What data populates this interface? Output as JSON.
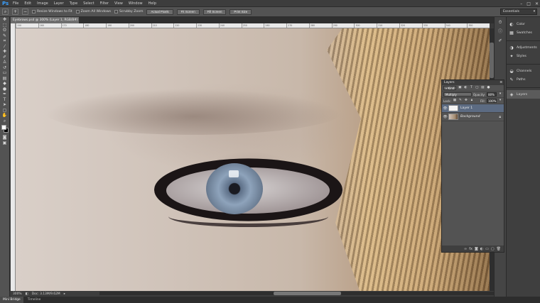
{
  "app": {
    "logo": "Ps"
  },
  "menu": [
    "File",
    "Edit",
    "Image",
    "Layer",
    "Type",
    "Select",
    "Filter",
    "View",
    "Window",
    "Help"
  ],
  "window_controls": {
    "minimize": "–",
    "maximize": "□",
    "close": "✕"
  },
  "options": {
    "resize_label": "Resize Windows to Fit",
    "zoom_all_label": "Zoom All Windows",
    "scrubby_label": "Scrubby Zoom",
    "actual_pixels": "Actual Pixels",
    "fit_screen": "Fit Screen",
    "fill_screen": "Fill Screen",
    "print_size": "Print Size",
    "workspace": "Essentials"
  },
  "document": {
    "tab_title": "Eyebrows.psd @ 300% (Layer 1, RGB/8#)",
    "ruler_ticks": [
      "150",
      "160",
      "170",
      "180",
      "190",
      "200",
      "210",
      "220",
      "230",
      "240",
      "250",
      "260",
      "270",
      "280",
      "290",
      "300",
      "310",
      "320",
      "330",
      "340",
      "350"
    ]
  },
  "status": {
    "zoom": "300%",
    "doc": "Doc: 3.13M/9.62M"
  },
  "bottom_tabs": [
    "Mini Bridge",
    "Timeline"
  ],
  "dock": {
    "items": [
      {
        "label": "Color",
        "icon": "◐"
      },
      {
        "label": "Swatches",
        "icon": "▦"
      },
      {
        "label": "Adjustments",
        "icon": "◑"
      },
      {
        "label": "Styles",
        "icon": "✦"
      },
      {
        "label": "Channels",
        "icon": "◒"
      },
      {
        "label": "Paths",
        "icon": "✎"
      },
      {
        "label": "Layers",
        "icon": "◈"
      }
    ]
  },
  "layers_panel": {
    "title": "Layers",
    "filter_kind": "Kind",
    "blend_mode": "Multiply",
    "opacity_label": "Opacity:",
    "opacity_value": "80%",
    "lock_label": "Lock:",
    "fill_label": "Fill:",
    "fill_value": "100%",
    "layers": [
      {
        "name": "Layer 1",
        "selected": true
      },
      {
        "name": "Background",
        "selected": false
      }
    ]
  }
}
